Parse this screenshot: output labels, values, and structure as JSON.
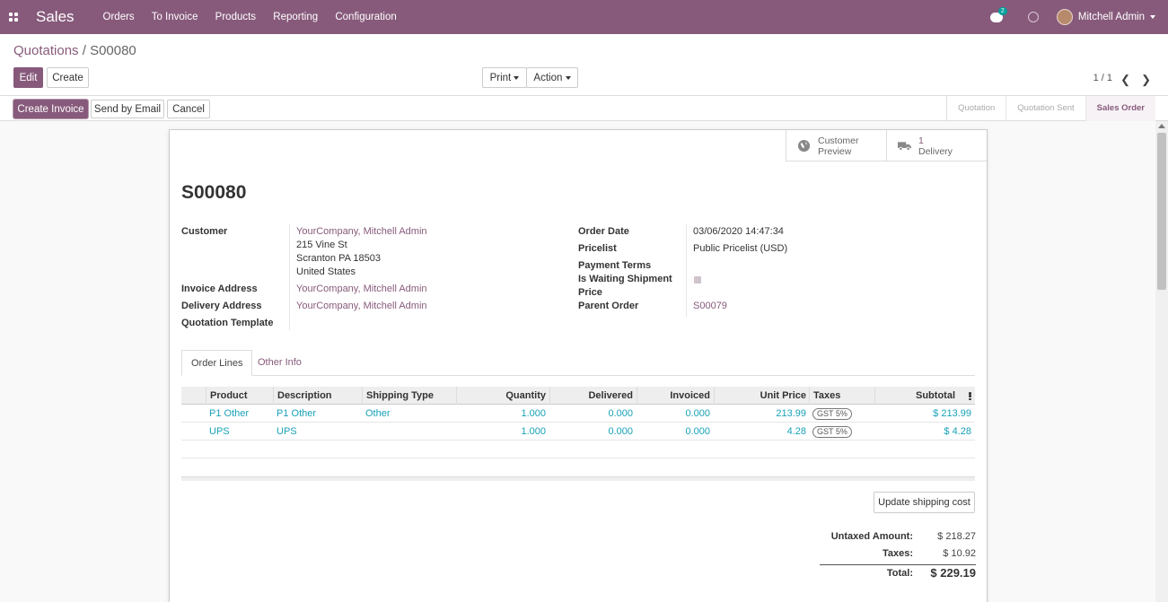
{
  "navbar": {
    "app_title": "Sales",
    "menu": [
      "Orders",
      "To Invoice",
      "Products",
      "Reporting",
      "Configuration"
    ],
    "chat_badge": "2",
    "user_name": "Mitchell Admin",
    "accent_color": "#875a7b"
  },
  "control_panel": {
    "breadcrumb_parent": "Quotations",
    "breadcrumb_sep": " / ",
    "breadcrumb_current": "S00080",
    "edit_label": "Edit",
    "create_label": "Create",
    "print_label": "Print",
    "action_label": "Action",
    "pager": "1 / 1",
    "prev_icon": "chevron-left-icon",
    "next_icon": "chevron-right-icon"
  },
  "header_buttons": {
    "create_invoice": "Create Invoice",
    "send_email": "Send by Email",
    "cancel": "Cancel"
  },
  "status_steps": [
    {
      "label": "Quotation",
      "active": false
    },
    {
      "label": "Quotation Sent",
      "active": false
    },
    {
      "label": "Sales Order",
      "active": true
    }
  ],
  "smart_buttons": {
    "preview_line1": "Customer",
    "preview_line2": "Preview",
    "delivery_count": "1",
    "delivery_label": "Delivery"
  },
  "record": {
    "name": "S00080",
    "left_labels": {
      "customer": "Customer",
      "invoice_address": "Invoice Address",
      "delivery_address": "Delivery Address",
      "quotation_template": "Quotation Template"
    },
    "customer": {
      "name": "YourCompany, Mitchell Admin",
      "street": "215 Vine St",
      "city": "Scranton PA 18503",
      "country": "United States"
    },
    "invoice_address": "YourCompany, Mitchell Admin",
    "delivery_address": "YourCompany, Mitchell Admin",
    "right_labels": {
      "order_date": "Order Date",
      "pricelist": "Pricelist",
      "payment_terms": "Payment Terms",
      "waiting_line1": "Is Waiting Shipment",
      "waiting_line2": "Price",
      "parent_order": "Parent Order"
    },
    "order_date": "03/06/2020 14:47:34",
    "pricelist": "Public Pricelist (USD)",
    "parent_order": "S00079"
  },
  "tabs": [
    "Order Lines",
    "Other Info"
  ],
  "order_lines": {
    "headers": [
      "Product",
      "Description",
      "Shipping Type",
      "Quantity",
      "Delivered",
      "Invoiced",
      "Unit Price",
      "Taxes",
      "Subtotal"
    ],
    "rows": [
      {
        "product": "P1 Other",
        "description": "P1 Other",
        "shipping_type": "Other",
        "quantity": "1.000",
        "delivered": "0.000",
        "invoiced": "0.000",
        "unit_price": "213.99",
        "tax": "GST 5%",
        "subtotal": "$ 213.99"
      },
      {
        "product": "UPS",
        "description": "UPS",
        "shipping_type": "",
        "quantity": "1.000",
        "delivered": "0.000",
        "invoiced": "0.000",
        "unit_price": "4.28",
        "tax": "GST 5%",
        "subtotal": "$ 4.28"
      }
    ]
  },
  "update_shipping_label": "Update shipping cost",
  "totals": {
    "untaxed_label": "Untaxed Amount:",
    "untaxed": "$ 218.27",
    "taxes_label": "Taxes:",
    "taxes": "$ 10.92",
    "total_label": "Total:",
    "total": "$ 229.19"
  }
}
